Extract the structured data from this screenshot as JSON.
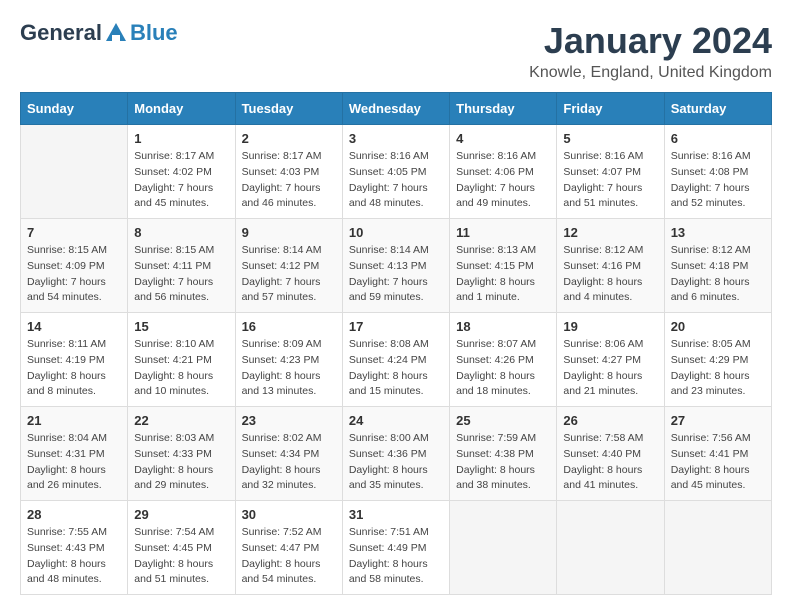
{
  "logo": {
    "general": "General",
    "blue": "Blue"
  },
  "title": "January 2024",
  "location": "Knowle, England, United Kingdom",
  "days_of_week": [
    "Sunday",
    "Monday",
    "Tuesday",
    "Wednesday",
    "Thursday",
    "Friday",
    "Saturday"
  ],
  "weeks": [
    [
      {
        "day": "",
        "sunrise": "",
        "sunset": "",
        "daylight": "",
        "empty": true
      },
      {
        "day": "1",
        "sunrise": "Sunrise: 8:17 AM",
        "sunset": "Sunset: 4:02 PM",
        "daylight": "Daylight: 7 hours and 45 minutes."
      },
      {
        "day": "2",
        "sunrise": "Sunrise: 8:17 AM",
        "sunset": "Sunset: 4:03 PM",
        "daylight": "Daylight: 7 hours and 46 minutes."
      },
      {
        "day": "3",
        "sunrise": "Sunrise: 8:16 AM",
        "sunset": "Sunset: 4:05 PM",
        "daylight": "Daylight: 7 hours and 48 minutes."
      },
      {
        "day": "4",
        "sunrise": "Sunrise: 8:16 AM",
        "sunset": "Sunset: 4:06 PM",
        "daylight": "Daylight: 7 hours and 49 minutes."
      },
      {
        "day": "5",
        "sunrise": "Sunrise: 8:16 AM",
        "sunset": "Sunset: 4:07 PM",
        "daylight": "Daylight: 7 hours and 51 minutes."
      },
      {
        "day": "6",
        "sunrise": "Sunrise: 8:16 AM",
        "sunset": "Sunset: 4:08 PM",
        "daylight": "Daylight: 7 hours and 52 minutes."
      }
    ],
    [
      {
        "day": "7",
        "sunrise": "Sunrise: 8:15 AM",
        "sunset": "Sunset: 4:09 PM",
        "daylight": "Daylight: 7 hours and 54 minutes."
      },
      {
        "day": "8",
        "sunrise": "Sunrise: 8:15 AM",
        "sunset": "Sunset: 4:11 PM",
        "daylight": "Daylight: 7 hours and 56 minutes."
      },
      {
        "day": "9",
        "sunrise": "Sunrise: 8:14 AM",
        "sunset": "Sunset: 4:12 PM",
        "daylight": "Daylight: 7 hours and 57 minutes."
      },
      {
        "day": "10",
        "sunrise": "Sunrise: 8:14 AM",
        "sunset": "Sunset: 4:13 PM",
        "daylight": "Daylight: 7 hours and 59 minutes."
      },
      {
        "day": "11",
        "sunrise": "Sunrise: 8:13 AM",
        "sunset": "Sunset: 4:15 PM",
        "daylight": "Daylight: 8 hours and 1 minute."
      },
      {
        "day": "12",
        "sunrise": "Sunrise: 8:12 AM",
        "sunset": "Sunset: 4:16 PM",
        "daylight": "Daylight: 8 hours and 4 minutes."
      },
      {
        "day": "13",
        "sunrise": "Sunrise: 8:12 AM",
        "sunset": "Sunset: 4:18 PM",
        "daylight": "Daylight: 8 hours and 6 minutes."
      }
    ],
    [
      {
        "day": "14",
        "sunrise": "Sunrise: 8:11 AM",
        "sunset": "Sunset: 4:19 PM",
        "daylight": "Daylight: 8 hours and 8 minutes."
      },
      {
        "day": "15",
        "sunrise": "Sunrise: 8:10 AM",
        "sunset": "Sunset: 4:21 PM",
        "daylight": "Daylight: 8 hours and 10 minutes."
      },
      {
        "day": "16",
        "sunrise": "Sunrise: 8:09 AM",
        "sunset": "Sunset: 4:23 PM",
        "daylight": "Daylight: 8 hours and 13 minutes."
      },
      {
        "day": "17",
        "sunrise": "Sunrise: 8:08 AM",
        "sunset": "Sunset: 4:24 PM",
        "daylight": "Daylight: 8 hours and 15 minutes."
      },
      {
        "day": "18",
        "sunrise": "Sunrise: 8:07 AM",
        "sunset": "Sunset: 4:26 PM",
        "daylight": "Daylight: 8 hours and 18 minutes."
      },
      {
        "day": "19",
        "sunrise": "Sunrise: 8:06 AM",
        "sunset": "Sunset: 4:27 PM",
        "daylight": "Daylight: 8 hours and 21 minutes."
      },
      {
        "day": "20",
        "sunrise": "Sunrise: 8:05 AM",
        "sunset": "Sunset: 4:29 PM",
        "daylight": "Daylight: 8 hours and 23 minutes."
      }
    ],
    [
      {
        "day": "21",
        "sunrise": "Sunrise: 8:04 AM",
        "sunset": "Sunset: 4:31 PM",
        "daylight": "Daylight: 8 hours and 26 minutes."
      },
      {
        "day": "22",
        "sunrise": "Sunrise: 8:03 AM",
        "sunset": "Sunset: 4:33 PM",
        "daylight": "Daylight: 8 hours and 29 minutes."
      },
      {
        "day": "23",
        "sunrise": "Sunrise: 8:02 AM",
        "sunset": "Sunset: 4:34 PM",
        "daylight": "Daylight: 8 hours and 32 minutes."
      },
      {
        "day": "24",
        "sunrise": "Sunrise: 8:00 AM",
        "sunset": "Sunset: 4:36 PM",
        "daylight": "Daylight: 8 hours and 35 minutes."
      },
      {
        "day": "25",
        "sunrise": "Sunrise: 7:59 AM",
        "sunset": "Sunset: 4:38 PM",
        "daylight": "Daylight: 8 hours and 38 minutes."
      },
      {
        "day": "26",
        "sunrise": "Sunrise: 7:58 AM",
        "sunset": "Sunset: 4:40 PM",
        "daylight": "Daylight: 8 hours and 41 minutes."
      },
      {
        "day": "27",
        "sunrise": "Sunrise: 7:56 AM",
        "sunset": "Sunset: 4:41 PM",
        "daylight": "Daylight: 8 hours and 45 minutes."
      }
    ],
    [
      {
        "day": "28",
        "sunrise": "Sunrise: 7:55 AM",
        "sunset": "Sunset: 4:43 PM",
        "daylight": "Daylight: 8 hours and 48 minutes."
      },
      {
        "day": "29",
        "sunrise": "Sunrise: 7:54 AM",
        "sunset": "Sunset: 4:45 PM",
        "daylight": "Daylight: 8 hours and 51 minutes."
      },
      {
        "day": "30",
        "sunrise": "Sunrise: 7:52 AM",
        "sunset": "Sunset: 4:47 PM",
        "daylight": "Daylight: 8 hours and 54 minutes."
      },
      {
        "day": "31",
        "sunrise": "Sunrise: 7:51 AM",
        "sunset": "Sunset: 4:49 PM",
        "daylight": "Daylight: 8 hours and 58 minutes."
      },
      {
        "day": "",
        "sunrise": "",
        "sunset": "",
        "daylight": "",
        "empty": true
      },
      {
        "day": "",
        "sunrise": "",
        "sunset": "",
        "daylight": "",
        "empty": true
      },
      {
        "day": "",
        "sunrise": "",
        "sunset": "",
        "daylight": "",
        "empty": true
      }
    ]
  ]
}
